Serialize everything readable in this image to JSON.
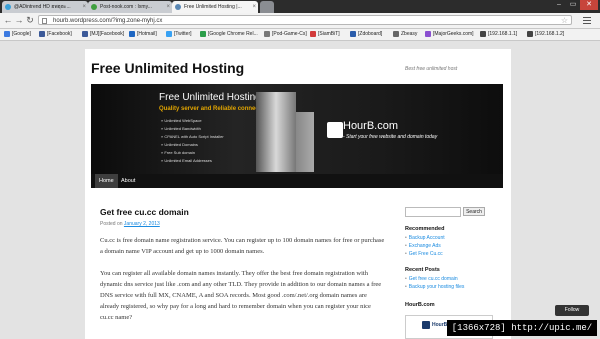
{
  "tabs": [
    {
      "label": "@ADintrend HD ฮพฮุฮะ...",
      "icon": "twitter-icon",
      "color": "#3aa0d8"
    },
    {
      "label": "Post-nook.com : Ixmy...",
      "icon": "globe-icon",
      "color": "#40a040"
    },
    {
      "label": "Free Unlimited Hosting |...",
      "icon": "wordpress-icon",
      "color": "#5a87b3"
    }
  ],
  "window_controls": {
    "minimize": "–",
    "maximize": "▭",
    "close": "✕"
  },
  "address": {
    "url": "hourb.wordpress.com/?img.zone-myhj.cx"
  },
  "bookmarks": [
    {
      "label": "[Google]",
      "color": "#3c7ae0"
    },
    {
      "label": "[Facebook]",
      "color": "#3b5998"
    },
    {
      "label": "[MJ][Facebook]",
      "color": "#3b5998"
    },
    {
      "label": "[Hotmail]",
      "color": "#1e66c2"
    },
    {
      "label": "[Twitter]",
      "color": "#38a1f3"
    },
    {
      "label": "[Google Chrome Rel...",
      "color": "#2c9e4a"
    },
    {
      "label": "[Pod-Game-Cs]",
      "color": "#777777"
    },
    {
      "label": "[SiamBiT]",
      "color": "#d23a3a"
    },
    {
      "label": "[Zdoboard]",
      "color": "#2a5caa"
    },
    {
      "label": "Zbeasy",
      "color": "#666666"
    },
    {
      "label": "[MajorGeeks.com]",
      "color": "#8a4fd0"
    },
    {
      "label": "[192.168.1.1]",
      "color": "#444444"
    },
    {
      "label": "[192.168.1.2]",
      "color": "#444444"
    }
  ],
  "site": {
    "title": "Free Unlimited Hosting",
    "description": "Best free unlimited host"
  },
  "banner": {
    "heading": "Free Unlimited Hosting",
    "subheading": "Quality server and Reliable connection",
    "features": [
      "» Unlimited WebSpace",
      "» Unlimited Bandwidth",
      "» CPANEL with Auto Script Installer",
      "» Unlimited Domains",
      "» Free Sub domain",
      "» Unlimited Email Addresses"
    ],
    "logo": "HourB.com",
    "tagline": "- Start your free website and domain today"
  },
  "nav": [
    {
      "label": "Home"
    },
    {
      "label": "About"
    }
  ],
  "post": {
    "title": "Get free cu.cc domain",
    "posted_prefix": "Posted on",
    "date": "January 2, 2013",
    "paragraphs": [
      "Cu.cc is free domain name registration service. You can register up to 100 domain names for free or purchase a domain name VIP account and get up to 1000 domain names.",
      "You can register all available domain names instantly. They offer the best free domain registration with dynamic dns service just like .com and any other TLD. They provide in addition to our domain names a free DNS service with full MX, CNAME, A and SOA records. Most good .com/.net/.org domain names are already registered, so why pay for a long and hard to remember domain when you can register your nice cu.cc name?"
    ]
  },
  "sidebar": {
    "search_button": "Search",
    "recommended_title": "Recommended",
    "recommended": [
      "Backup Account",
      "Exchange Ads",
      "Get Free Cu.cc"
    ],
    "recent_title": "Recent Posts",
    "recent": [
      "Get free cu.cc domain",
      "Backup your hosting files"
    ],
    "widget_title": "HourB.com",
    "widget_image_text": "HourB.com"
  },
  "follow_label": "Follow",
  "caption": "[1366x728] http://upic.me/"
}
